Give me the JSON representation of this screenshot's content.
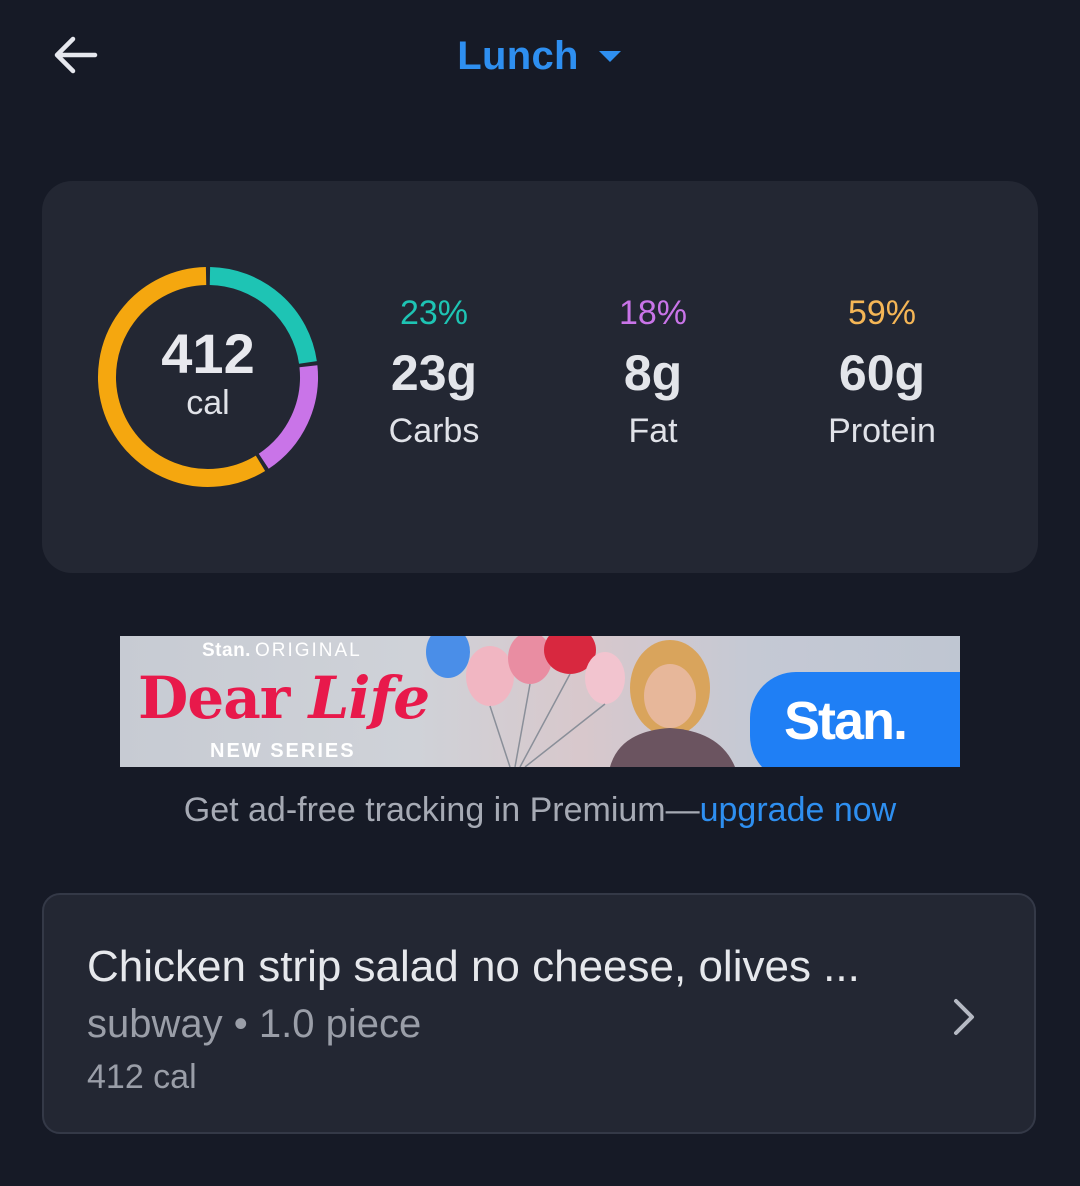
{
  "header": {
    "meal_title": "Lunch"
  },
  "summary": {
    "calories": "412",
    "calories_unit": "cal",
    "macros": [
      {
        "key": "carbs",
        "percent": "23%",
        "grams": "23g",
        "label": "Carbs",
        "color": "#1ec4b4",
        "fraction": 0.23
      },
      {
        "key": "fat",
        "percent": "18%",
        "grams": "8g",
        "label": "Fat",
        "color": "#c974e8",
        "fraction": 0.18
      },
      {
        "key": "protein",
        "percent": "59%",
        "grams": "60g",
        "label": "Protein",
        "color": "#f5a70f",
        "fraction": 0.59
      }
    ]
  },
  "ad": {
    "brand_small": "Stan.",
    "brand_tag": "ORIGINAL",
    "title_part1": "Dear ",
    "title_part2": "Life",
    "subtitle": "NEW SERIES",
    "logo": "Stan."
  },
  "premium": {
    "text": "Get ad-free tracking in Premium—",
    "link": "upgrade now"
  },
  "entry": {
    "name": "Chicken strip salad no cheese, olives ...",
    "subtitle": "subway • 1.0 piece",
    "calories": "412 cal"
  },
  "colors": {
    "accent": "#2e8ff0",
    "background": "#161a26",
    "card": "#232733"
  }
}
